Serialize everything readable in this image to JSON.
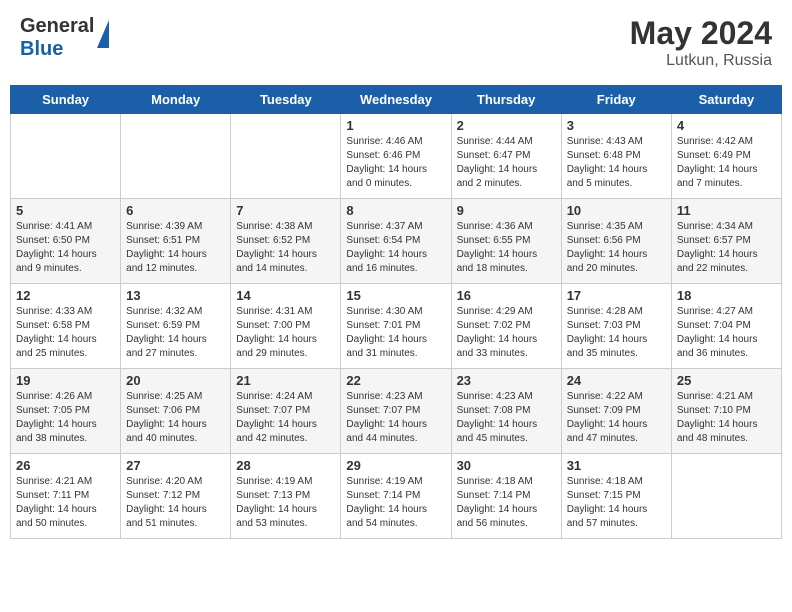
{
  "header": {
    "logo_general": "General",
    "logo_blue": "Blue",
    "month_year": "May 2024",
    "location": "Lutkun, Russia"
  },
  "days_of_week": [
    "Sunday",
    "Monday",
    "Tuesday",
    "Wednesday",
    "Thursday",
    "Friday",
    "Saturday"
  ],
  "weeks": [
    [
      {
        "day": "",
        "sunrise": "",
        "sunset": "",
        "daylight": ""
      },
      {
        "day": "",
        "sunrise": "",
        "sunset": "",
        "daylight": ""
      },
      {
        "day": "",
        "sunrise": "",
        "sunset": "",
        "daylight": ""
      },
      {
        "day": "1",
        "sunrise": "Sunrise: 4:46 AM",
        "sunset": "Sunset: 6:46 PM",
        "daylight": "Daylight: 14 hours and 0 minutes."
      },
      {
        "day": "2",
        "sunrise": "Sunrise: 4:44 AM",
        "sunset": "Sunset: 6:47 PM",
        "daylight": "Daylight: 14 hours and 2 minutes."
      },
      {
        "day": "3",
        "sunrise": "Sunrise: 4:43 AM",
        "sunset": "Sunset: 6:48 PM",
        "daylight": "Daylight: 14 hours and 5 minutes."
      },
      {
        "day": "4",
        "sunrise": "Sunrise: 4:42 AM",
        "sunset": "Sunset: 6:49 PM",
        "daylight": "Daylight: 14 hours and 7 minutes."
      }
    ],
    [
      {
        "day": "5",
        "sunrise": "Sunrise: 4:41 AM",
        "sunset": "Sunset: 6:50 PM",
        "daylight": "Daylight: 14 hours and 9 minutes."
      },
      {
        "day": "6",
        "sunrise": "Sunrise: 4:39 AM",
        "sunset": "Sunset: 6:51 PM",
        "daylight": "Daylight: 14 hours and 12 minutes."
      },
      {
        "day": "7",
        "sunrise": "Sunrise: 4:38 AM",
        "sunset": "Sunset: 6:52 PM",
        "daylight": "Daylight: 14 hours and 14 minutes."
      },
      {
        "day": "8",
        "sunrise": "Sunrise: 4:37 AM",
        "sunset": "Sunset: 6:54 PM",
        "daylight": "Daylight: 14 hours and 16 minutes."
      },
      {
        "day": "9",
        "sunrise": "Sunrise: 4:36 AM",
        "sunset": "Sunset: 6:55 PM",
        "daylight": "Daylight: 14 hours and 18 minutes."
      },
      {
        "day": "10",
        "sunrise": "Sunrise: 4:35 AM",
        "sunset": "Sunset: 6:56 PM",
        "daylight": "Daylight: 14 hours and 20 minutes."
      },
      {
        "day": "11",
        "sunrise": "Sunrise: 4:34 AM",
        "sunset": "Sunset: 6:57 PM",
        "daylight": "Daylight: 14 hours and 22 minutes."
      }
    ],
    [
      {
        "day": "12",
        "sunrise": "Sunrise: 4:33 AM",
        "sunset": "Sunset: 6:58 PM",
        "daylight": "Daylight: 14 hours and 25 minutes."
      },
      {
        "day": "13",
        "sunrise": "Sunrise: 4:32 AM",
        "sunset": "Sunset: 6:59 PM",
        "daylight": "Daylight: 14 hours and 27 minutes."
      },
      {
        "day": "14",
        "sunrise": "Sunrise: 4:31 AM",
        "sunset": "Sunset: 7:00 PM",
        "daylight": "Daylight: 14 hours and 29 minutes."
      },
      {
        "day": "15",
        "sunrise": "Sunrise: 4:30 AM",
        "sunset": "Sunset: 7:01 PM",
        "daylight": "Daylight: 14 hours and 31 minutes."
      },
      {
        "day": "16",
        "sunrise": "Sunrise: 4:29 AM",
        "sunset": "Sunset: 7:02 PM",
        "daylight": "Daylight: 14 hours and 33 minutes."
      },
      {
        "day": "17",
        "sunrise": "Sunrise: 4:28 AM",
        "sunset": "Sunset: 7:03 PM",
        "daylight": "Daylight: 14 hours and 35 minutes."
      },
      {
        "day": "18",
        "sunrise": "Sunrise: 4:27 AM",
        "sunset": "Sunset: 7:04 PM",
        "daylight": "Daylight: 14 hours and 36 minutes."
      }
    ],
    [
      {
        "day": "19",
        "sunrise": "Sunrise: 4:26 AM",
        "sunset": "Sunset: 7:05 PM",
        "daylight": "Daylight: 14 hours and 38 minutes."
      },
      {
        "day": "20",
        "sunrise": "Sunrise: 4:25 AM",
        "sunset": "Sunset: 7:06 PM",
        "daylight": "Daylight: 14 hours and 40 minutes."
      },
      {
        "day": "21",
        "sunrise": "Sunrise: 4:24 AM",
        "sunset": "Sunset: 7:07 PM",
        "daylight": "Daylight: 14 hours and 42 minutes."
      },
      {
        "day": "22",
        "sunrise": "Sunrise: 4:23 AM",
        "sunset": "Sunset: 7:07 PM",
        "daylight": "Daylight: 14 hours and 44 minutes."
      },
      {
        "day": "23",
        "sunrise": "Sunrise: 4:23 AM",
        "sunset": "Sunset: 7:08 PM",
        "daylight": "Daylight: 14 hours and 45 minutes."
      },
      {
        "day": "24",
        "sunrise": "Sunrise: 4:22 AM",
        "sunset": "Sunset: 7:09 PM",
        "daylight": "Daylight: 14 hours and 47 minutes."
      },
      {
        "day": "25",
        "sunrise": "Sunrise: 4:21 AM",
        "sunset": "Sunset: 7:10 PM",
        "daylight": "Daylight: 14 hours and 48 minutes."
      }
    ],
    [
      {
        "day": "26",
        "sunrise": "Sunrise: 4:21 AM",
        "sunset": "Sunset: 7:11 PM",
        "daylight": "Daylight: 14 hours and 50 minutes."
      },
      {
        "day": "27",
        "sunrise": "Sunrise: 4:20 AM",
        "sunset": "Sunset: 7:12 PM",
        "daylight": "Daylight: 14 hours and 51 minutes."
      },
      {
        "day": "28",
        "sunrise": "Sunrise: 4:19 AM",
        "sunset": "Sunset: 7:13 PM",
        "daylight": "Daylight: 14 hours and 53 minutes."
      },
      {
        "day": "29",
        "sunrise": "Sunrise: 4:19 AM",
        "sunset": "Sunset: 7:14 PM",
        "daylight": "Daylight: 14 hours and 54 minutes."
      },
      {
        "day": "30",
        "sunrise": "Sunrise: 4:18 AM",
        "sunset": "Sunset: 7:14 PM",
        "daylight": "Daylight: 14 hours and 56 minutes."
      },
      {
        "day": "31",
        "sunrise": "Sunrise: 4:18 AM",
        "sunset": "Sunset: 7:15 PM",
        "daylight": "Daylight: 14 hours and 57 minutes."
      },
      {
        "day": "",
        "sunrise": "",
        "sunset": "",
        "daylight": ""
      }
    ]
  ]
}
